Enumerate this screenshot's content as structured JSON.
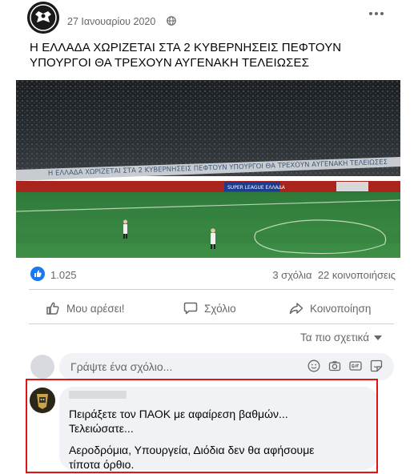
{
  "post": {
    "date": "27 Ιανουαρίου 2020",
    "text": "Η ΕΛΛΑΔΑ ΧΩΡΙΖΕΤΑΙ ΣΤΑ 2 ΚΥΒΕΡΝΗΣΕΙΣ ΠΕΦΤΟΥΝ ΥΠΟΥΡΓΟΙ ΘΑ ΤΡΕΧΟΥΝ ΑΥΓΕΝΑΚΗ ΤΕΛΕΙΩΣΕΣ",
    "audience_icon": "globe-icon",
    "more_icon": "more-icon"
  },
  "photo": {
    "banner_text": "Η ΕΛΛΑΔΑ ΧΩΡΙΖΕΤΑΙ ΣΤΑ 2 ΚΥΒΕΡΝΗΣΕΙΣ ΠΕΦΤΟΥΝ ΥΠΟΥΡΓΟΙ ΘΑ ΤΡΕΧΟΥΝ ΑΥΓΕΝΑΚΗ ΤΕΛΕΙΩΣΕΣ",
    "board_text": "SUPER LEAGUE ΕΛΛΑΔΑ"
  },
  "reactions": {
    "like_count": "1.025",
    "comments": "3 σχόλια",
    "shares": "22 κοινοποιήσεις"
  },
  "actions": {
    "like": "Μου αρέσει!",
    "comment": "Σχόλιο",
    "share": "Κοινοποίηση"
  },
  "sort": {
    "label": "Τα πιο σχετικά"
  },
  "comment_box": {
    "placeholder": "Γράψτε ένα σχόλιο..."
  },
  "comment": {
    "line1": "Πειράξετε τον ΠΑΟΚ με αφαίρεση βαθμών...",
    "line2": "Τελειώσατε...",
    "line3": "Αεροδρόμια, Υπουργεία, Διόδια δεν θα αφήσουμε",
    "line4": "τίποτα όρθιο."
  },
  "colors": {
    "facebook_blue": "#1877f2",
    "highlight_red": "#e01414",
    "text_secondary": "#65676b"
  }
}
